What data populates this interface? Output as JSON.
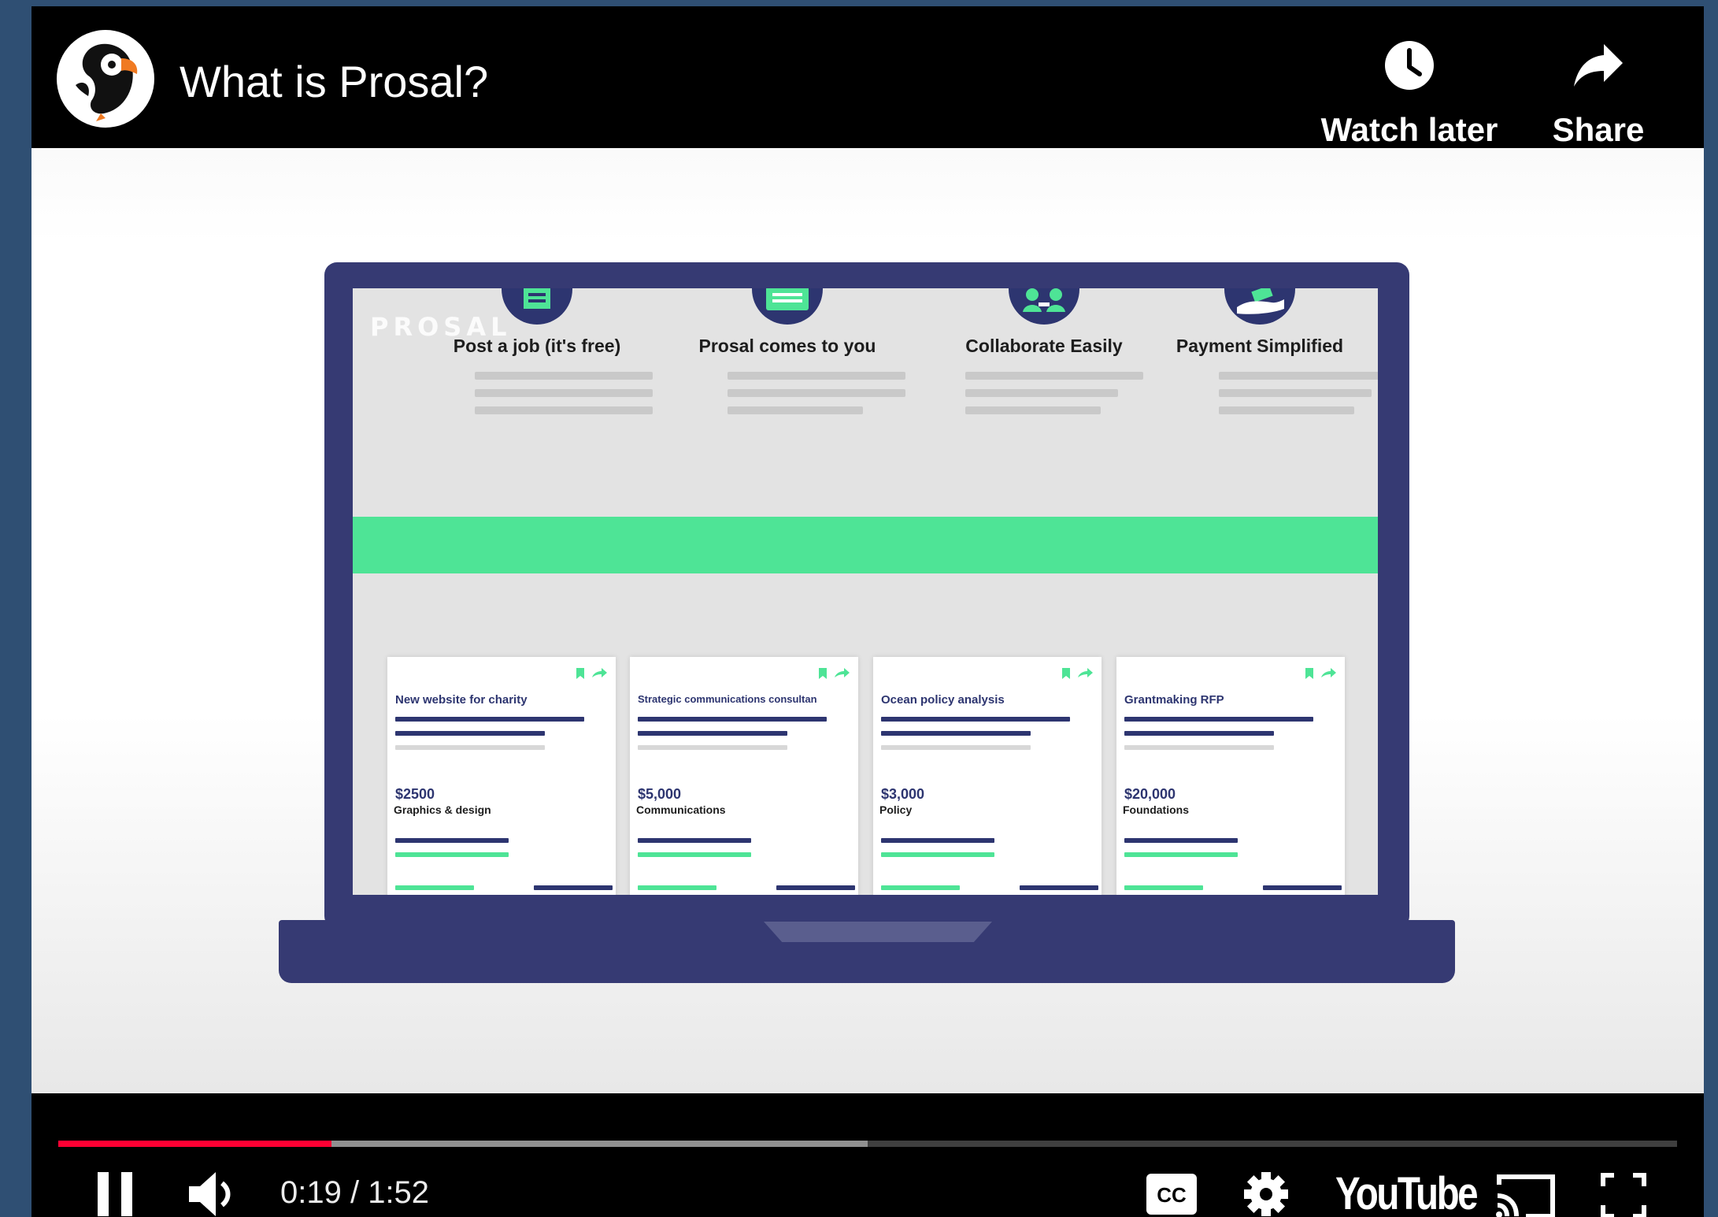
{
  "video": {
    "title": "What is Prosal?",
    "channel_avatar": "puffin-logo-icon"
  },
  "top_actions": {
    "watch_later_label": "Watch later",
    "share_label": "Share"
  },
  "content": {
    "logo_text": "PROSAL",
    "features": [
      {
        "title": "Post a job (it's free)",
        "icon": "document-icon"
      },
      {
        "title": "Prosal comes to you",
        "icon": "message-icon"
      },
      {
        "title": "Collaborate Easily",
        "icon": "people-icon"
      },
      {
        "title": "Payment Simplified",
        "icon": "hand-money-icon"
      }
    ],
    "cards": [
      {
        "title": "New website for charity",
        "price": "$2500",
        "category": "Graphics & design"
      },
      {
        "title": "Strategic communications consultan",
        "price": "$5,000",
        "category": "Communications"
      },
      {
        "title": "Ocean policy analysis",
        "price": "$3,000",
        "category": "Policy"
      },
      {
        "title": "Grantmaking RFP",
        "price": "$20,000",
        "category": "Foundations"
      }
    ],
    "colors": {
      "navy": "#2d3570",
      "green": "#4ee496",
      "laptop": "#363a73"
    }
  },
  "player": {
    "time_display": "0:19 / 1:52",
    "played_fraction": 0.169,
    "buffered_fraction": 0.5,
    "brand": "YouTube",
    "progress_color": "#ff0033",
    "buttons": [
      "pause-icon",
      "volume-icon",
      "cc-icon",
      "settings-icon",
      "cast-icon",
      "fullscreen-icon"
    ]
  }
}
